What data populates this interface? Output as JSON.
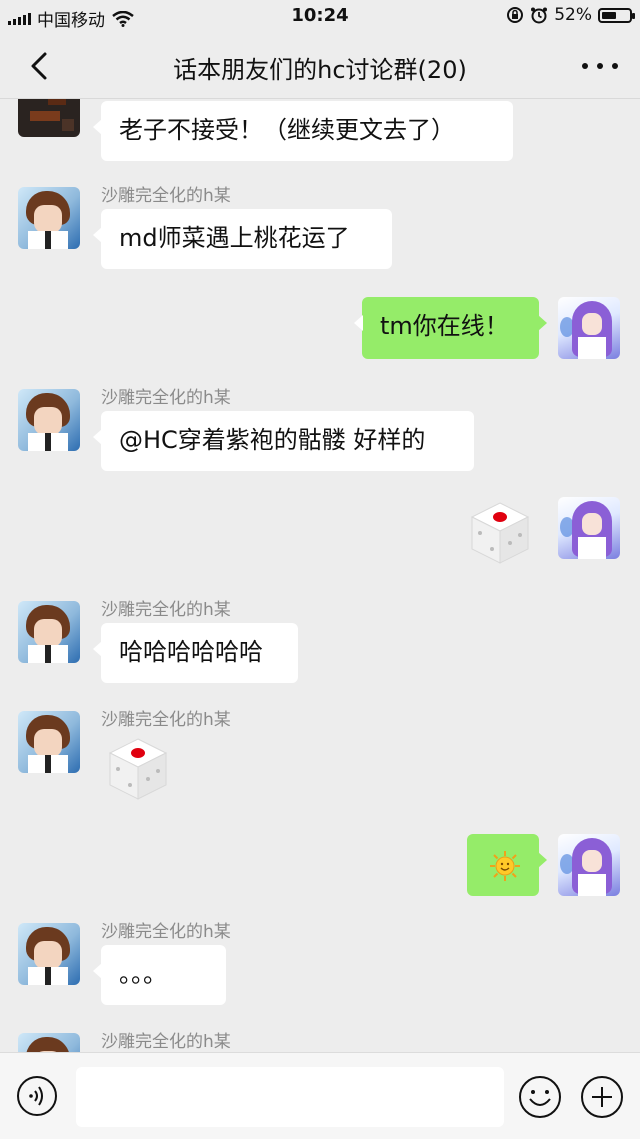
{
  "status_bar": {
    "carrier": "中国移动",
    "time": "10:24",
    "battery": "52%",
    "battery_level": 0.52,
    "icons": [
      "signal-icon",
      "wifi-icon",
      "rotation-lock-icon",
      "alarm-icon",
      "battery-icon"
    ]
  },
  "nav": {
    "title": "话本朋友们的hc讨论群(20)",
    "back_icon": "chevron-left-icon",
    "more_icon": "more-dots-icon"
  },
  "messages": [
    {
      "side": "left",
      "sender": "",
      "type": "text",
      "text": "老子不接受！（继续更文去了）"
    },
    {
      "side": "left",
      "sender": "沙雕完全化的h某",
      "type": "text",
      "text": "md师菜遇上桃花运了"
    },
    {
      "side": "right",
      "sender": "",
      "type": "text",
      "text": "tm你在线！"
    },
    {
      "side": "left",
      "sender": "沙雕完全化的h某",
      "type": "text",
      "text": "@HC穿着紫袍的骷髅 好样的"
    },
    {
      "side": "right",
      "sender": "",
      "type": "dice",
      "dice_value": 1
    },
    {
      "side": "left",
      "sender": "沙雕完全化的h某",
      "type": "text",
      "text": "哈哈哈哈哈哈"
    },
    {
      "side": "left",
      "sender": "沙雕完全化的h某",
      "type": "dice",
      "dice_value": 1
    },
    {
      "side": "right",
      "sender": "",
      "type": "emoji",
      "emoji": "sun-emoji"
    },
    {
      "side": "left",
      "sender": "沙雕完全化的h某",
      "type": "text",
      "text": "。。。"
    },
    {
      "side": "left",
      "sender": "沙雕完全化的h某",
      "type": "text",
      "text": ""
    }
  ],
  "input_bar": {
    "voice_icon": "voice-icon",
    "emoji_icon": "emoji-smile-icon",
    "plus_icon": "plus-circle-icon",
    "input_value": ""
  },
  "colors": {
    "background": "#ededed",
    "bubble_self": "#95ec69",
    "bubble_other": "#ffffff",
    "sender_name": "#8a8a8a"
  }
}
